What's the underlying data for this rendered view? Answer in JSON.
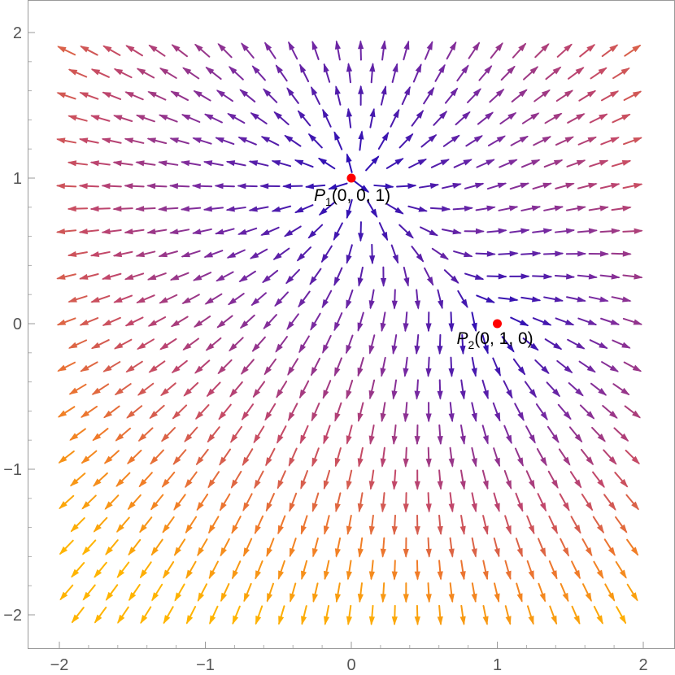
{
  "chart_data": {
    "type": "stream",
    "title": "",
    "xlabel": "",
    "ylabel": "",
    "xlim": [
      -2,
      2
    ],
    "ylim": [
      -2,
      2
    ],
    "x_ticks": [
      "−2",
      "−1",
      "0",
      "1",
      "2"
    ],
    "y_ticks": [
      "−2",
      "−1",
      "0",
      "1",
      "2"
    ],
    "x_tick_values": [
      -2,
      -1,
      0,
      1,
      2
    ],
    "y_tick_values": [
      -2,
      -1,
      0,
      1,
      2
    ],
    "field_sources": [
      [
        0,
        1
      ],
      [
        1,
        0
      ]
    ],
    "color_scale": [
      "#2a0fb6",
      "#7a2aa0",
      "#c2476a",
      "#f07a2a",
      "#ffb400"
    ],
    "points": [
      {
        "name": "P",
        "sub": "1",
        "coords": "(0, 0, 1)",
        "x": 0,
        "y": 1,
        "color": "#ff0000"
      },
      {
        "name": "P",
        "sub": "2",
        "coords": "(0, 1, 0)",
        "x": 1,
        "y": 0,
        "color": "#ff0000"
      }
    ],
    "grid": false,
    "legend": "none"
  }
}
